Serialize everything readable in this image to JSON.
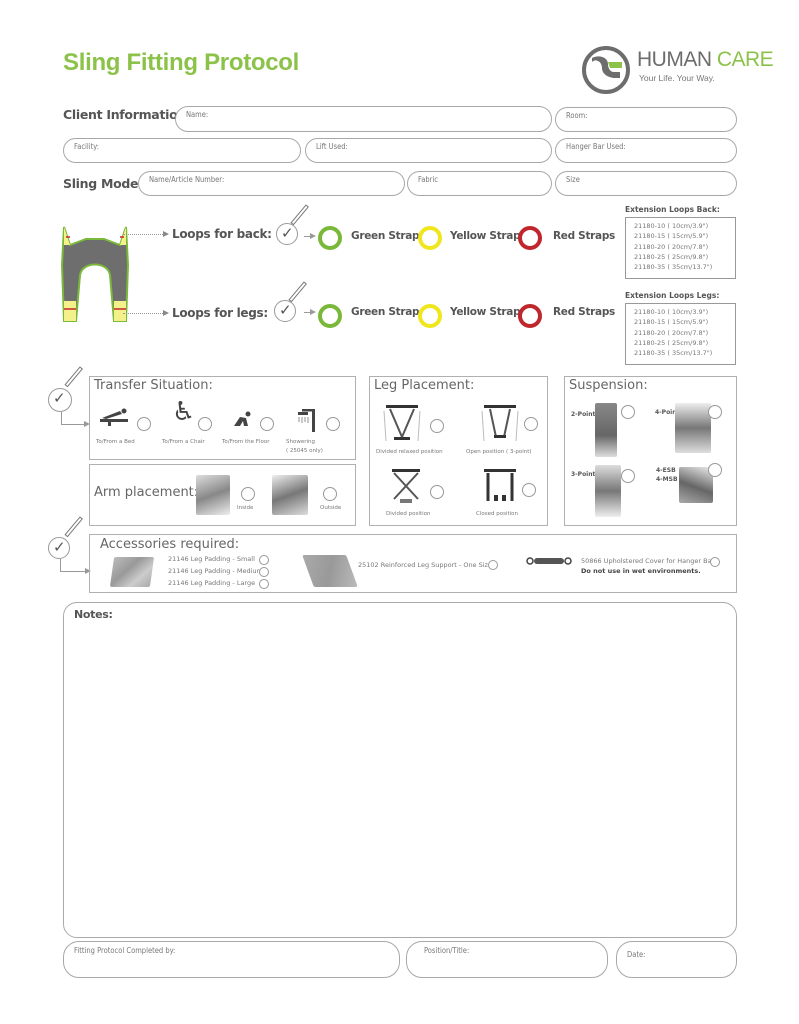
{
  "header": {
    "title": "Sling Fitting Protocol",
    "logo": {
      "brand_primary": "HUMAN",
      "brand_secondary": "CARE",
      "tagline": "Your Life. Your Way.",
      "icon": "human-care-logo-icon"
    }
  },
  "colors": {
    "accent": "#8cc24a",
    "green_strap": "#7ab83a",
    "yellow_strap": "#f0e61e",
    "red_strap": "#c0272d",
    "text": "#555555"
  },
  "client_information": {
    "label": "Client Information:",
    "fields": [
      {
        "label": "Name:",
        "value": ""
      },
      {
        "label": "Room:",
        "value": ""
      },
      {
        "label": "Facility:",
        "value": ""
      },
      {
        "label": "Lift Used:",
        "value": ""
      },
      {
        "label": "Hanger Bar Used:",
        "value": ""
      }
    ]
  },
  "sling_model": {
    "label": "Sling Model:",
    "fields": [
      {
        "label": "Name/Article Number:",
        "value": ""
      },
      {
        "label": "Fabric",
        "value": ""
      },
      {
        "label": "Size",
        "value": ""
      }
    ]
  },
  "loops": {
    "back": {
      "label": "Loops for back:",
      "options": [
        "Green Strap",
        "Yellow Strap",
        "Red Straps"
      ]
    },
    "legs": {
      "label": "Loops for legs:",
      "options": [
        "Green Strap",
        "Yellow Strap",
        "Red Straps"
      ]
    }
  },
  "extension_loops": {
    "back": {
      "title": "Extension Loops Back:",
      "items": [
        "21180-10 ( 10cm/3.9\")",
        "21180-15 ( 15cm/5.9\")",
        "21180-20 ( 20cm/7.8\")",
        "21180-25 ( 25cm/9.8\")",
        "21180-35 ( 35cm/13.7\")"
      ]
    },
    "legs": {
      "title": "Extension Loops Legs:",
      "items": [
        "21180-10 ( 10cm/3.9\")",
        "21180-15 ( 15cm/5.9\")",
        "21180-20 ( 20cm/7.8\")",
        "21180-25 ( 25cm/9.8\")",
        "21180-35 ( 35cm/13.7\")"
      ]
    }
  },
  "transfer_situation": {
    "title": "Transfer Situation:",
    "options": [
      {
        "label": "To/From a Bed",
        "icon": "bed-transfer-icon"
      },
      {
        "label": "To/From a Chair",
        "icon": "wheelchair-icon"
      },
      {
        "label": "To/From the Floor",
        "icon": "floor-transfer-icon"
      },
      {
        "label": "Showering",
        "sublabel": "( 25045 only)",
        "icon": "shower-icon"
      }
    ]
  },
  "arm_placement": {
    "title": "Arm placement:",
    "options": [
      {
        "label": "Inside"
      },
      {
        "label": "Outside"
      }
    ]
  },
  "leg_placement": {
    "title": "Leg Placement:",
    "options": [
      {
        "label": "Divided relaxed position"
      },
      {
        "label": "Open position ( 3-point)"
      },
      {
        "label": "Divided position"
      },
      {
        "label": "Closed position"
      }
    ]
  },
  "suspension": {
    "title": "Suspension:",
    "options": [
      {
        "label": "2-Point"
      },
      {
        "label": "4-Point"
      },
      {
        "label": "3-Point"
      },
      {
        "label": "4-ESB",
        "label2": "4-MSB"
      }
    ]
  },
  "accessories": {
    "title": "Accessories required:",
    "leg_padding": [
      "21146 Leg Padding - Small",
      "21146 Leg Padding - Medium",
      "21146 Leg Padding - Large"
    ],
    "leg_support": "25102 Reinforced Leg Support - One Size",
    "hanger_cover": "50866 Upholstered Cover for Hanger Bar",
    "hanger_cover_warning": "Do not use in wet environments."
  },
  "notes": {
    "label": "Notes:",
    "value": ""
  },
  "footer": {
    "fields": [
      {
        "label": "Fitting Protocol Completed by:",
        "value": ""
      },
      {
        "label": "Position/Title:",
        "value": ""
      },
      {
        "label": "Date:",
        "value": ""
      }
    ]
  }
}
